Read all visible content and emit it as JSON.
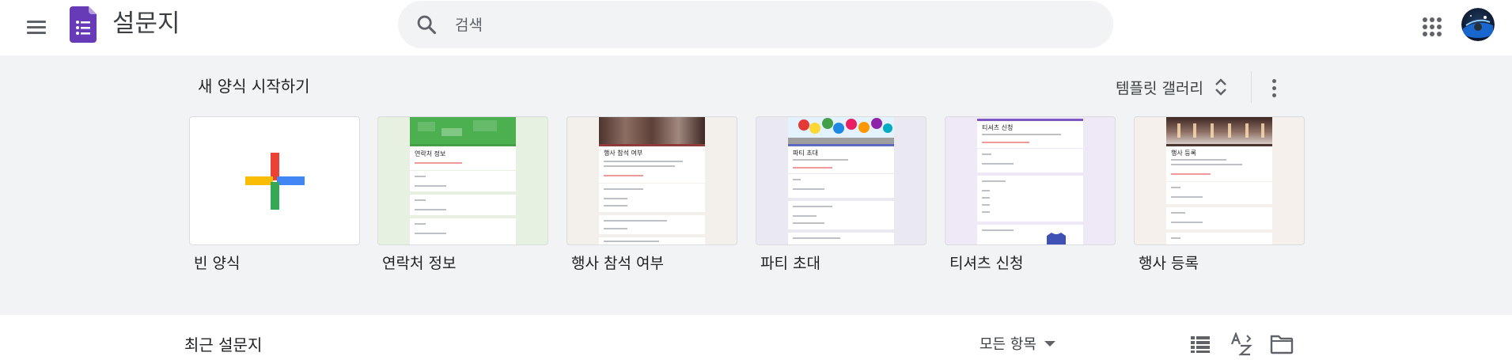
{
  "header": {
    "app_title": "설문지",
    "search": {
      "placeholder": "검색",
      "value": ""
    },
    "icons": [
      "menu-icon",
      "forms-logo-icon",
      "search-icon",
      "apps-grid-icon",
      "avatar"
    ]
  },
  "templates": {
    "heading": "새 양식 시작하기",
    "gallery_label": "템플릿 갤러리",
    "cards": [
      {
        "label": "빈 양식",
        "accent": "#ffffff"
      },
      {
        "label": "연락처 정보",
        "accent": "#43a047"
      },
      {
        "label": "행사 참석 여부",
        "accent": "#8d6e63"
      },
      {
        "label": "파티 초대",
        "accent": "#5c6bc0"
      },
      {
        "label": "티셔츠 신청",
        "accent": "#7e57c2"
      },
      {
        "label": "행사 등록",
        "accent": "#6d4c41"
      }
    ],
    "thumb_texts": {
      "contact": "연락처 정보",
      "rsvp": "행사 참석 여부",
      "party": "파티 초대",
      "tshirt": "티셔츠 신청",
      "registration": "행사 등록"
    }
  },
  "recent": {
    "title": "최근 설문지",
    "filter_label": "모든 항목"
  },
  "colors": {
    "section_bg": "#f1f3f4",
    "forms_purple": "#673ab7",
    "plus_red": "#ea4335",
    "plus_blue": "#4285f4",
    "plus_yellow": "#fbbc04",
    "plus_green": "#34a853"
  }
}
